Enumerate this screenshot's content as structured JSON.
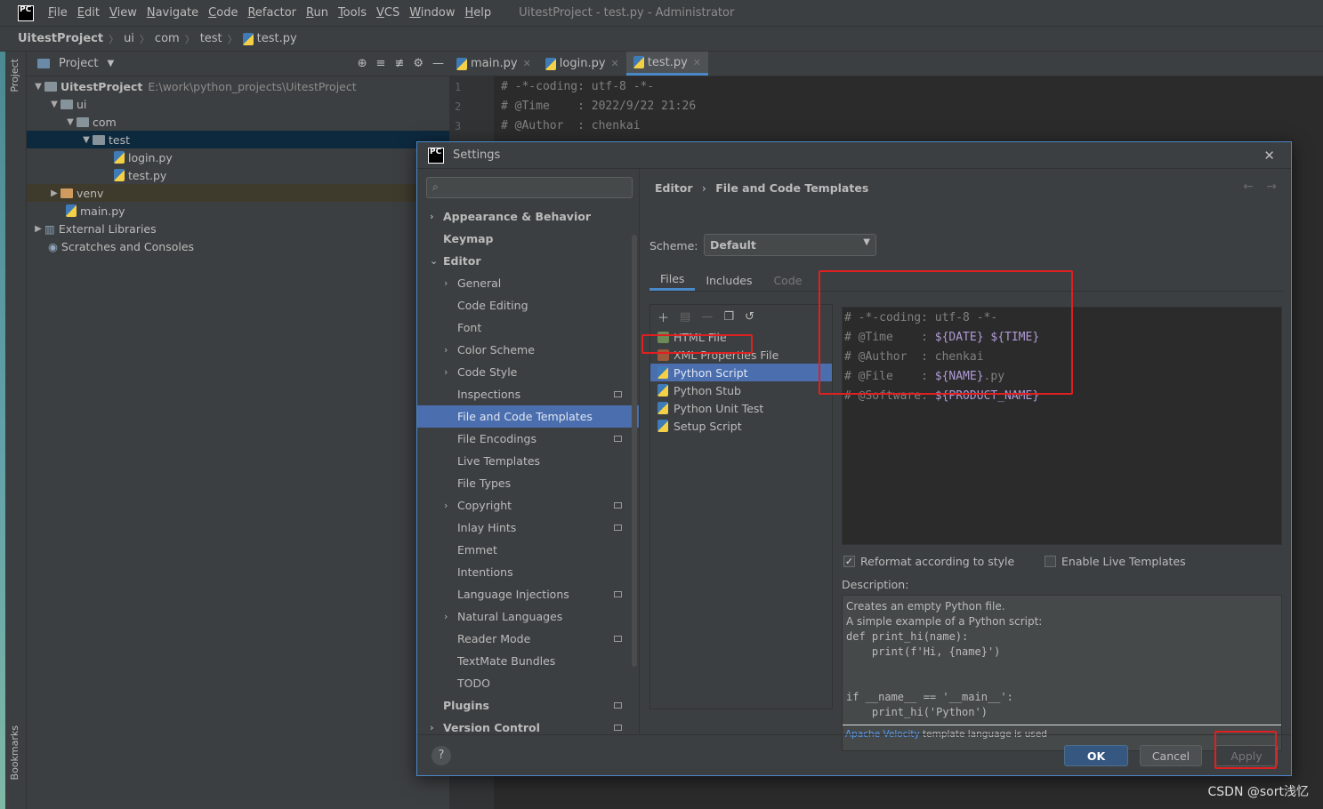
{
  "menubar": {
    "items": [
      "File",
      "Edit",
      "View",
      "Navigate",
      "Code",
      "Refactor",
      "Run",
      "Tools",
      "VCS",
      "Window",
      "Help"
    ],
    "window_title": "UitestProject - test.py - Administrator"
  },
  "breadcrumbs": [
    "UitestProject",
    "ui",
    "com",
    "test",
    "test.py"
  ],
  "left_stripe": {
    "project_label": "Project",
    "bookmarks_label": "Bookmarks"
  },
  "project_panel": {
    "title": "Project",
    "root_name": "UitestProject",
    "root_path": "E:\\work\\python_projects\\UitestProject",
    "folders": {
      "ui": "ui",
      "com": "com",
      "test": "test",
      "venv": "venv"
    },
    "files": {
      "login": "login.py",
      "test": "test.py",
      "main": "main.py"
    },
    "external_libraries": "External Libraries",
    "scratches": "Scratches and Consoles"
  },
  "editor": {
    "tabs": [
      "main.py",
      "login.py",
      "test.py"
    ],
    "active_tab": "test.py",
    "line_numbers": [
      "1",
      "2",
      "3"
    ],
    "lines": [
      "# -*-coding: utf-8 -*-",
      "# @Time    : 2022/9/22 21:26",
      "# @Author  : chenkai"
    ]
  },
  "settings": {
    "title": "Settings",
    "search_placeholder": "",
    "nav": {
      "appearance": "Appearance & Behavior",
      "keymap": "Keymap",
      "editor": "Editor",
      "general": "General",
      "code_editing": "Code Editing",
      "font": "Font",
      "color_scheme": "Color Scheme",
      "code_style": "Code Style",
      "inspections": "Inspections",
      "file_code_templates": "File and Code Templates",
      "file_encodings": "File Encodings",
      "live_templates": "Live Templates",
      "file_types": "File Types",
      "copyright": "Copyright",
      "inlay_hints": "Inlay Hints",
      "emmet": "Emmet",
      "intentions": "Intentions",
      "language_injections": "Language Injections",
      "natural_languages": "Natural Languages",
      "reader_mode": "Reader Mode",
      "textmate_bundles": "TextMate Bundles",
      "todo": "TODO",
      "plugins": "Plugins",
      "version_control": "Version Control"
    },
    "path_parent": "Editor",
    "path_current": "File and Code Templates",
    "scheme_label": "Scheme:",
    "scheme_value": "Default",
    "tabs": {
      "files": "Files",
      "includes": "Includes",
      "code": "Code"
    },
    "templates": {
      "html": "HTML File",
      "xml": "XML Properties File",
      "python_script": "Python Script",
      "python_stub": "Python Stub",
      "python_unit_test": "Python Unit Test",
      "setup_script": "Setup Script"
    },
    "template_text": {
      "l1": "# -*-coding: utf-8 -*-",
      "l2_prefix": "# @Time    : ",
      "l2_var1": "${DATE}",
      "l2_var2": "${TIME}",
      "l3": "# @Author  : chenkai",
      "l4_prefix": "# @File    : ",
      "l4_var": "${NAME}",
      "l4_suffix": ".py",
      "l5_prefix": "# @Software: ",
      "l5_var": "${PRODUCT_NAME}"
    },
    "reformat_label": "Reformat according to style",
    "reformat_checked": true,
    "live_templates_label": "Enable Live Templates",
    "live_templates_checked": false,
    "description_label": "Description:",
    "description": {
      "line1": "Creates an empty Python file.",
      "line2": "A simple example of a Python script:",
      "code1": "def print_hi(name):",
      "code2": "    print(f'Hi, {name}')",
      "code3": "if __name__ == '__main__':",
      "code4": "    print_hi('Python')",
      "foot_link": "Apache Velocity",
      "foot_text": " template language is used"
    },
    "buttons": {
      "help": "?",
      "ok": "OK",
      "cancel": "Cancel",
      "apply": "Apply"
    }
  },
  "watermark": "CSDN @sort浅忆",
  "colors": {
    "accent": "#4b6eaf",
    "highlight": "#e02020",
    "template_var": "#b09bd6"
  }
}
